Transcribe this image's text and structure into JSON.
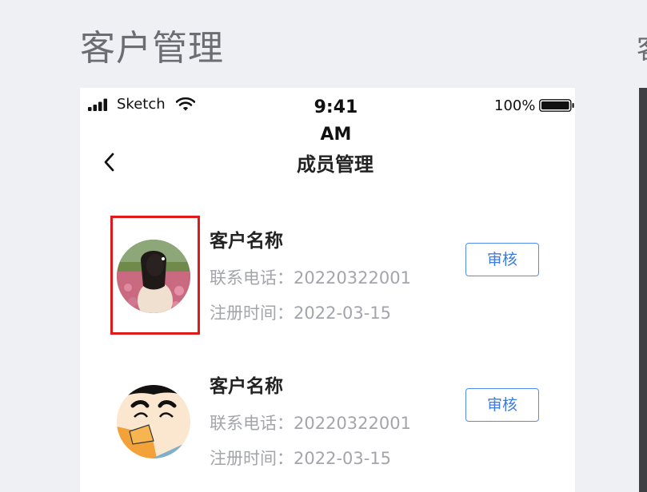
{
  "page": {
    "heading": "客户管理",
    "side_heading_fragment": "客"
  },
  "status_bar": {
    "carrier": "Sketch",
    "time": "9:41 AM",
    "battery_percent": "100%",
    "battery_level": 1.0
  },
  "nav": {
    "title": "成员管理",
    "back_icon": "chevron-left-icon"
  },
  "members": [
    {
      "name": "客户名称",
      "phone_label": "联系电话：",
      "phone": "20220322001",
      "register_label": "注册时间：",
      "register_date": "2022-03-15",
      "button_label": "审核",
      "avatar": "woman-in-field-avatar"
    },
    {
      "name": "客户名称",
      "phone_label": "联系电话：",
      "phone": "20220322001",
      "register_label": "注册时间：",
      "register_date": "2022-03-15",
      "button_label": "审核",
      "avatar": "cartoon-boy-avatar"
    }
  ],
  "colors": {
    "accent": "#3b7be6",
    "highlight": "#e01a1a",
    "muted_text": "#a3a5aa",
    "background": "#eff0f3"
  }
}
